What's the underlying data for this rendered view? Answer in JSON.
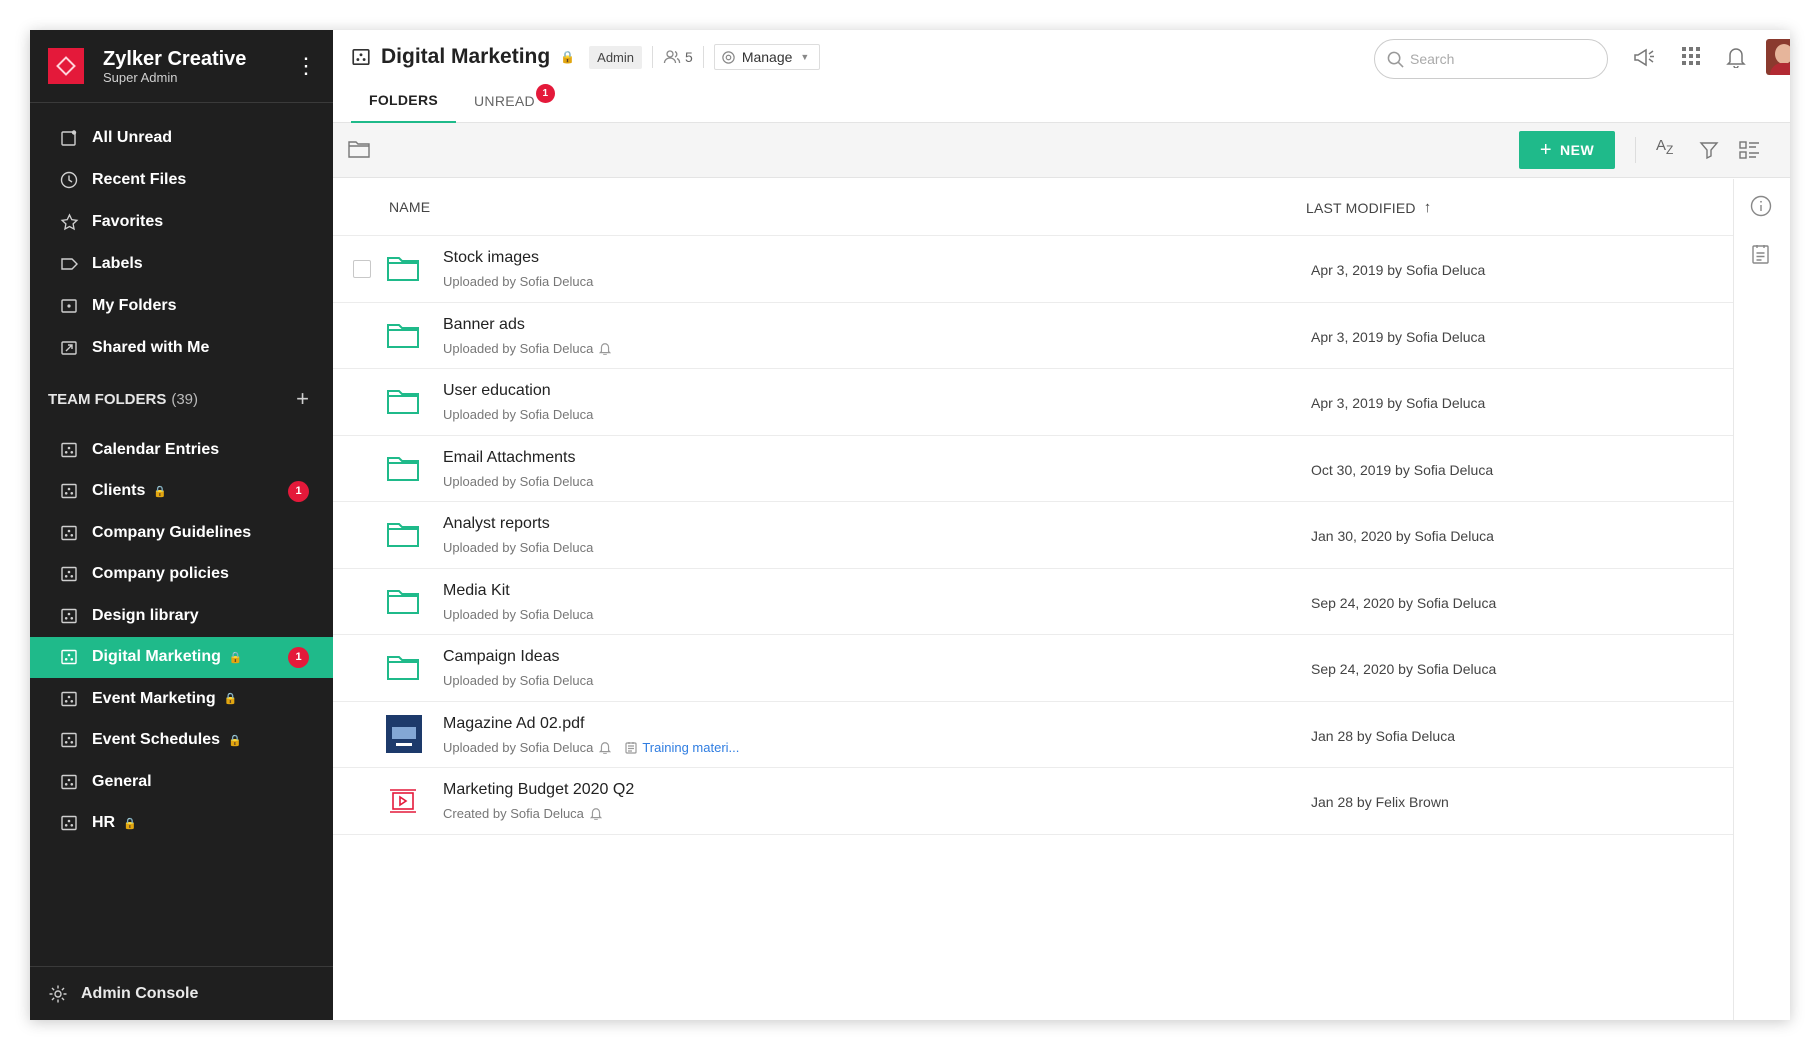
{
  "org": {
    "name": "Zylker Creative",
    "role": "Super Admin"
  },
  "nav": [
    {
      "label": "All Unread",
      "icon": "unread-icon"
    },
    {
      "label": "Recent Files",
      "icon": "clock-icon"
    },
    {
      "label": "Favorites",
      "icon": "star-icon"
    },
    {
      "label": "Labels",
      "icon": "label-icon"
    },
    {
      "label": "My Folders",
      "icon": "my-folders-icon"
    },
    {
      "label": "Shared with Me",
      "icon": "shared-icon"
    }
  ],
  "team_section": {
    "label": "TEAM FOLDERS",
    "count": "(39)"
  },
  "team_folders": [
    {
      "label": "Calendar Entries",
      "locked": false,
      "badge": "",
      "active": false
    },
    {
      "label": "Clients",
      "locked": true,
      "badge": "1",
      "active": false
    },
    {
      "label": "Company Guidelines",
      "locked": false,
      "badge": "",
      "active": false
    },
    {
      "label": "Company policies",
      "locked": false,
      "badge": "",
      "active": false
    },
    {
      "label": "Design library",
      "locked": false,
      "badge": "",
      "active": false
    },
    {
      "label": "Digital Marketing",
      "locked": true,
      "badge": "1",
      "active": true
    },
    {
      "label": "Event Marketing",
      "locked": true,
      "badge": "",
      "active": false
    },
    {
      "label": "Event Schedules",
      "locked": true,
      "badge": "",
      "active": false
    },
    {
      "label": "General",
      "locked": false,
      "badge": "",
      "active": false
    },
    {
      "label": "HR",
      "locked": true,
      "badge": "",
      "active": false
    }
  ],
  "admin_console": "Admin Console",
  "header": {
    "title": "Digital Marketing",
    "role_tag": "Admin",
    "members": "5",
    "manage": "Manage",
    "tabs": [
      {
        "label": "FOLDERS",
        "badge": ""
      },
      {
        "label": "UNREAD",
        "badge": "1"
      }
    ],
    "search_placeholder": "Search"
  },
  "toolbar": {
    "new_label": "NEW",
    "sort_label": "A",
    "sort_sub": "Z"
  },
  "columns": {
    "name": "NAME",
    "modified": "LAST MODIFIED"
  },
  "rows": [
    {
      "name": "Stock images",
      "sub": "Uploaded by Sofia Deluca",
      "bell": false,
      "link": "",
      "modified": "Apr 3, 2019 by Sofia Deluca",
      "kind": "folder"
    },
    {
      "name": "Banner ads",
      "sub": "Uploaded by Sofia Deluca",
      "bell": true,
      "link": "",
      "modified": "Apr 3, 2019 by Sofia Deluca",
      "kind": "folder"
    },
    {
      "name": "User education",
      "sub": "Uploaded by Sofia Deluca",
      "bell": false,
      "link": "",
      "modified": "Apr 3, 2019 by Sofia Deluca",
      "kind": "folder"
    },
    {
      "name": "Email Attachments",
      "sub": "Uploaded by Sofia Deluca",
      "bell": false,
      "link": "",
      "modified": "Oct 30, 2019 by Sofia Deluca",
      "kind": "folder"
    },
    {
      "name": "Analyst reports",
      "sub": "Uploaded by Sofia Deluca",
      "bell": false,
      "link": "",
      "modified": "Jan 30, 2020 by Sofia Deluca",
      "kind": "folder"
    },
    {
      "name": "Media Kit",
      "sub": "Uploaded by Sofia Deluca",
      "bell": false,
      "link": "",
      "modified": "Sep 24, 2020 by Sofia Deluca",
      "kind": "folder"
    },
    {
      "name": "Campaign Ideas",
      "sub": "Uploaded by Sofia Deluca",
      "bell": false,
      "link": "",
      "modified": "Sep 24, 2020 by Sofia Deluca",
      "kind": "folder"
    },
    {
      "name": "Magazine Ad 02.pdf",
      "sub": "Uploaded by Sofia Deluca",
      "bell": true,
      "link": "Training materi...",
      "modified": "Jan 28 by Sofia Deluca",
      "kind": "pdf"
    },
    {
      "name": "Marketing Budget 2020 Q2",
      "sub": "Created by Sofia Deluca",
      "bell": true,
      "link": "",
      "modified": "Jan 28 by Felix Brown",
      "kind": "presentation"
    }
  ],
  "colors": {
    "accent": "#1fba8a",
    "sidebar": "#1f1f1f",
    "badge": "#e4193a",
    "link": "#2f7de1"
  }
}
